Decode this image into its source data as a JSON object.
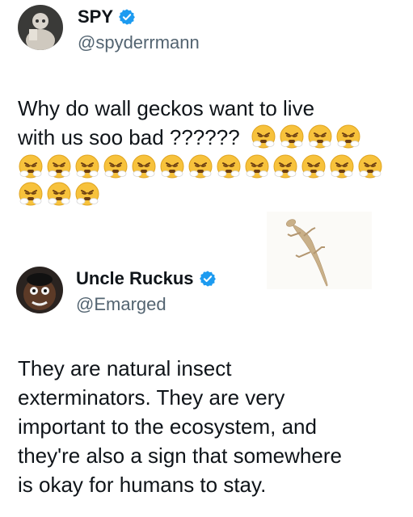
{
  "tweet1": {
    "display_name": "SPY",
    "handle": "@spyderrmann",
    "text_line1": "Why do wall geckos want to live",
    "text_line2": "with us soo bad ??????",
    "emoji_count_line2": 4,
    "emoji_count_line3": 13,
    "emoji_count_line4": 3,
    "emoji_name": "face-with-steam-from-nose-icon"
  },
  "tweet2": {
    "display_name": "Uncle Ruckus",
    "handle": "@Emarged",
    "text_lines": [
      "They are natural insect",
      "exterminators. They are very",
      "important to the ecosystem, and",
      "they're also a sign that somewhere",
      "is okay for humans to stay."
    ]
  },
  "colors": {
    "verified": "#1d9bf0",
    "handle": "#536471",
    "text": "#0f1419"
  }
}
